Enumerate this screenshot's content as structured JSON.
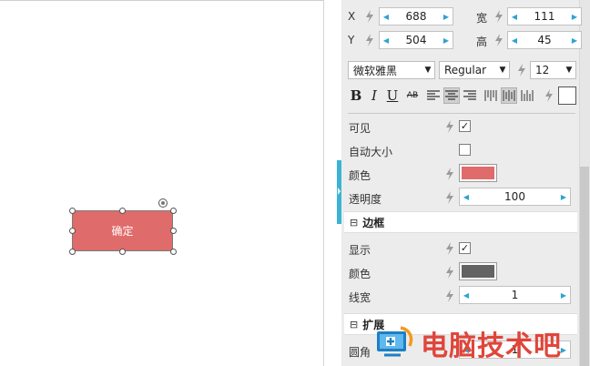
{
  "widget": {
    "label": "确定",
    "fill_color": "#e06b6b"
  },
  "geometry": {
    "x_label": "X",
    "x_value": "688",
    "y_label": "Y",
    "y_value": "504",
    "w_label": "宽",
    "w_value": "111",
    "h_label": "高",
    "h_value": "45"
  },
  "font": {
    "family": "微软雅黑",
    "style": "Regular",
    "size": "12"
  },
  "toolbar": {
    "bold": "B",
    "italic": "I",
    "underline": "U",
    "strike": "AB"
  },
  "props": {
    "visible_label": "可见",
    "visible_checked": "✓",
    "autosize_label": "自动大小",
    "autosize_checked": "",
    "color_label": "颜色",
    "color_value": "#e06b6b",
    "opacity_label": "透明度",
    "opacity_value": "100"
  },
  "border": {
    "section_title": "边框",
    "toggle": "⊟",
    "show_label": "显示",
    "show_checked": "✓",
    "color_label": "颜色",
    "color_value": "#636363",
    "width_label": "线宽",
    "width_value": "1"
  },
  "extend": {
    "section_title": "扩展",
    "toggle": "⊟",
    "radius_label": "圆角",
    "radius_value": "1"
  },
  "watermark": {
    "text": "电脑技术吧"
  },
  "colors": {
    "accent": "#2ea4cf",
    "drag_bar": "#3ab3d6"
  }
}
